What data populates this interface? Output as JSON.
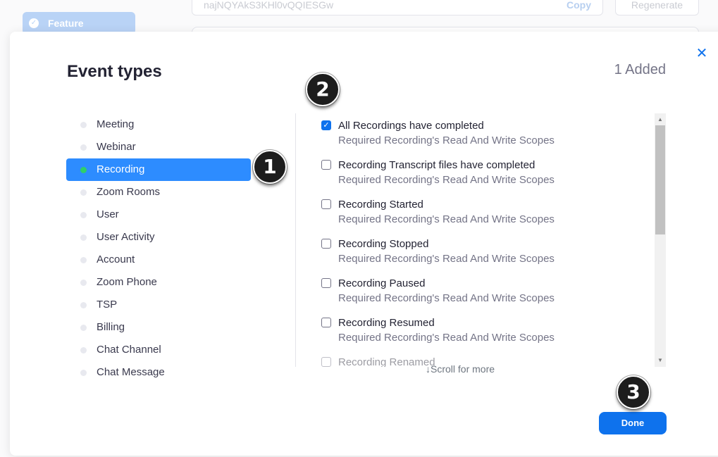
{
  "background": {
    "feature_label": "Feature",
    "token_text": "najNQYAkS3KHl0vQQIESGw",
    "copy_label": "Copy",
    "regenerate_label": "Regenerate"
  },
  "modal": {
    "title": "Event types",
    "added_count": "1 Added",
    "close_icon": "close-icon",
    "done_label": "Done",
    "scroll_hint": "↓Scroll for more"
  },
  "categories": [
    {
      "label": "Meeting"
    },
    {
      "label": "Webinar"
    },
    {
      "label": "Recording",
      "active": true
    },
    {
      "label": "Zoom Rooms"
    },
    {
      "label": "User"
    },
    {
      "label": "User Activity"
    },
    {
      "label": "Account"
    },
    {
      "label": "Zoom Phone"
    },
    {
      "label": "TSP"
    },
    {
      "label": "Billing"
    },
    {
      "label": "Chat Channel"
    },
    {
      "label": "Chat Message"
    }
  ],
  "events": [
    {
      "name": "All Recordings have completed",
      "requirement": "Required Recording's Read And Write Scopes",
      "checked": true
    },
    {
      "name": "Recording Transcript files have completed",
      "requirement": "Required Recording's Read And Write Scopes",
      "checked": false
    },
    {
      "name": "Recording Started",
      "requirement": "Required Recording's Read And Write Scopes",
      "checked": false
    },
    {
      "name": "Recording Stopped",
      "requirement": "Required Recording's Read And Write Scopes",
      "checked": false
    },
    {
      "name": "Recording Paused",
      "requirement": "Required Recording's Read And Write Scopes",
      "checked": false
    },
    {
      "name": "Recording Resumed",
      "requirement": "Required Recording's Read And Write Scopes",
      "checked": false
    },
    {
      "name": "Recording Renamed",
      "requirement": "",
      "checked": false
    }
  ],
  "callouts": [
    "1",
    "2",
    "3"
  ],
  "colors": {
    "accent": "#0e72ed",
    "active_category": "#2d8cff",
    "active_dot": "#2fcf6a"
  }
}
